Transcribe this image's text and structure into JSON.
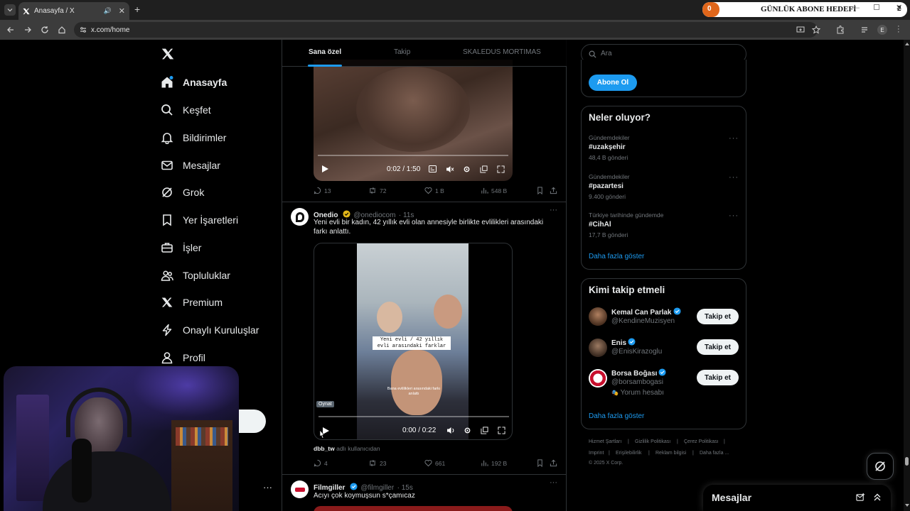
{
  "browser": {
    "tab_title": "Anasayfa / X",
    "url": "x.com/home",
    "subscriber_goal": "GÜNLÜK ABONE HEDEFİ",
    "subscriber_count": "0",
    "subscriber_target": "2",
    "profile_initial": "E"
  },
  "nav": {
    "items": [
      {
        "label": "Anasayfa",
        "icon": "home-icon"
      },
      {
        "label": "Keşfet",
        "icon": "search-icon"
      },
      {
        "label": "Bildirimler",
        "icon": "bell-icon"
      },
      {
        "label": "Mesajlar",
        "icon": "mail-icon"
      },
      {
        "label": "Grok",
        "icon": "grok-icon"
      },
      {
        "label": "Yer İşaretleri",
        "icon": "bookmark-icon"
      },
      {
        "label": "İşler",
        "icon": "briefcase-icon"
      },
      {
        "label": "Topluluklar",
        "icon": "people-icon"
      },
      {
        "label": "Premium",
        "icon": "x-logo-icon"
      },
      {
        "label": "Onaylı Kuruluşlar",
        "icon": "lightning-icon"
      },
      {
        "label": "Profil",
        "icon": "person-icon"
      }
    ],
    "more_dots": "···"
  },
  "feed": {
    "tabs": [
      "Sana özel",
      "Takip",
      "SKALEDUS MORTIMAS"
    ],
    "tweet1": {
      "time": "0:02 / 1:50",
      "replies": "13",
      "retweets": "72",
      "likes": "1 B",
      "views": "548 B"
    },
    "tweet2": {
      "name": "Onedio",
      "handle": "@onediocom",
      "age": "· 11s",
      "text": "Yeni evli bir kadın, 42 yıllık evli olan annesiyle birlikte evlilikleri arasındaki farkı anlattı.",
      "overlay_line1": "Yeni evli / 42 yıllık",
      "overlay_line2": "evli arasındaki farklar",
      "overlay_small": "Bana evlilikleri arasındaki farkı anlattı",
      "play_tooltip": "Oynat",
      "time": "0:00 / 0:22",
      "credit_user": "dbb_tw",
      "credit_text": "adlı kullanıcıdan",
      "replies": "4",
      "retweets": "23",
      "likes": "661",
      "views": "192 B"
    },
    "tweet3": {
      "name": "Filmgiller",
      "handle": "@filmgiller",
      "age": "· 15s",
      "text": "Acıyı çok koymuşsun s*çamıcaz"
    }
  },
  "right": {
    "search_placeholder": "Ara",
    "subscribe_button": "Abone Ol",
    "trends_title": "Neler oluyor?",
    "trends": [
      {
        "context": "Gündemdekiler",
        "name": "#uzakşehir",
        "count": "48,4 B gönderi"
      },
      {
        "context": "Gündemdekiler",
        "name": "#pazartesi",
        "count": "9.400 gönderi"
      },
      {
        "context": "Türkiye tarihinde gündemde",
        "name": "#CihAl",
        "count": "17,7 B gönderi"
      }
    ],
    "show_more": "Daha fazla göster",
    "follow_title": "Kimi takip etmeli",
    "suggestions": [
      {
        "name": "Kemal Can Parlak",
        "handle": "@KendineMuzisyen",
        "button": "Takip et"
      },
      {
        "name": "Enis",
        "handle": "@EnisKirazoglu",
        "button": "Takip et"
      },
      {
        "name": "Borsa Boğası",
        "handle": "@borsambogasi",
        "note": "Yorum hesabı",
        "button": "Takip et"
      }
    ],
    "footer": [
      "Hizmet Şartları",
      "Gizlilik Politikası",
      "Çerez Politikası",
      "Imprint",
      "Erişilebilirlik",
      "Reklam bilgisi",
      "Daha fazla ...",
      "© 2025 X Corp."
    ]
  },
  "messages_drawer": {
    "title": "Mesajlar"
  },
  "colors": {
    "accent": "#1d9bf0",
    "background": "#000000",
    "border": "#2f3336"
  }
}
